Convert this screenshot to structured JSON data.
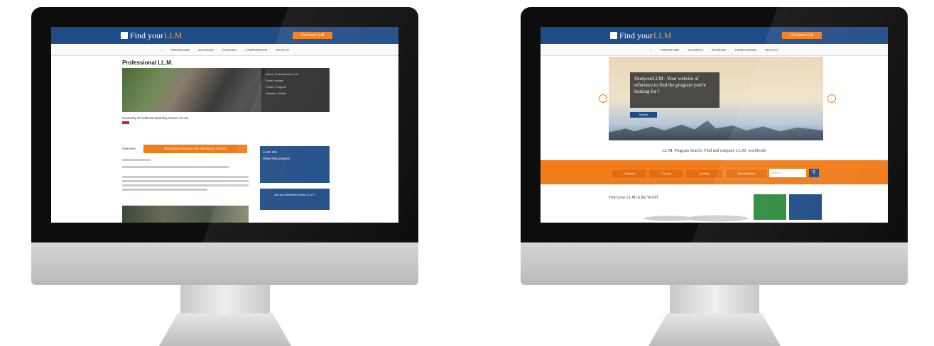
{
  "site": {
    "logo_prefix": "Find your ",
    "logo_llm": "LLM",
    "cta": "Find your LLM",
    "nav": [
      "PROGRAMS",
      "SCHOOLS",
      "RANKING",
      "COMPARISON",
      "SEARCH"
    ]
  },
  "page1": {
    "title": "Professional LL.M.",
    "info": [
      "Name: Professional LL.M.",
      "Email: contact",
      "Phone: Program",
      "Website: Details"
    ],
    "university": "University of California Berkeley School of Law",
    "tab_overview": "Overview",
    "tab_bar": "Description  Program Info  Admission  Contact",
    "sidebox": "LL.M. Info",
    "sidebox_line2": "Share this program",
    "sidebox2": "Are you interested in this LL.M.?"
  },
  "page2": {
    "hero_text": "FindyourLLM - Your website of reference to find the program you're looking for !",
    "hero_button": "Search",
    "search_title": "LL.M. Program Search: Find and compare LL.M. worldwide",
    "filters": [
      "Category",
      "Country",
      "Duration",
      "Specialization"
    ],
    "search_placeholder": "Search...",
    "world": "Find your LLM in the World"
  },
  "colors": {
    "navy": "#1f4c86",
    "orange": "#f07c1a"
  }
}
